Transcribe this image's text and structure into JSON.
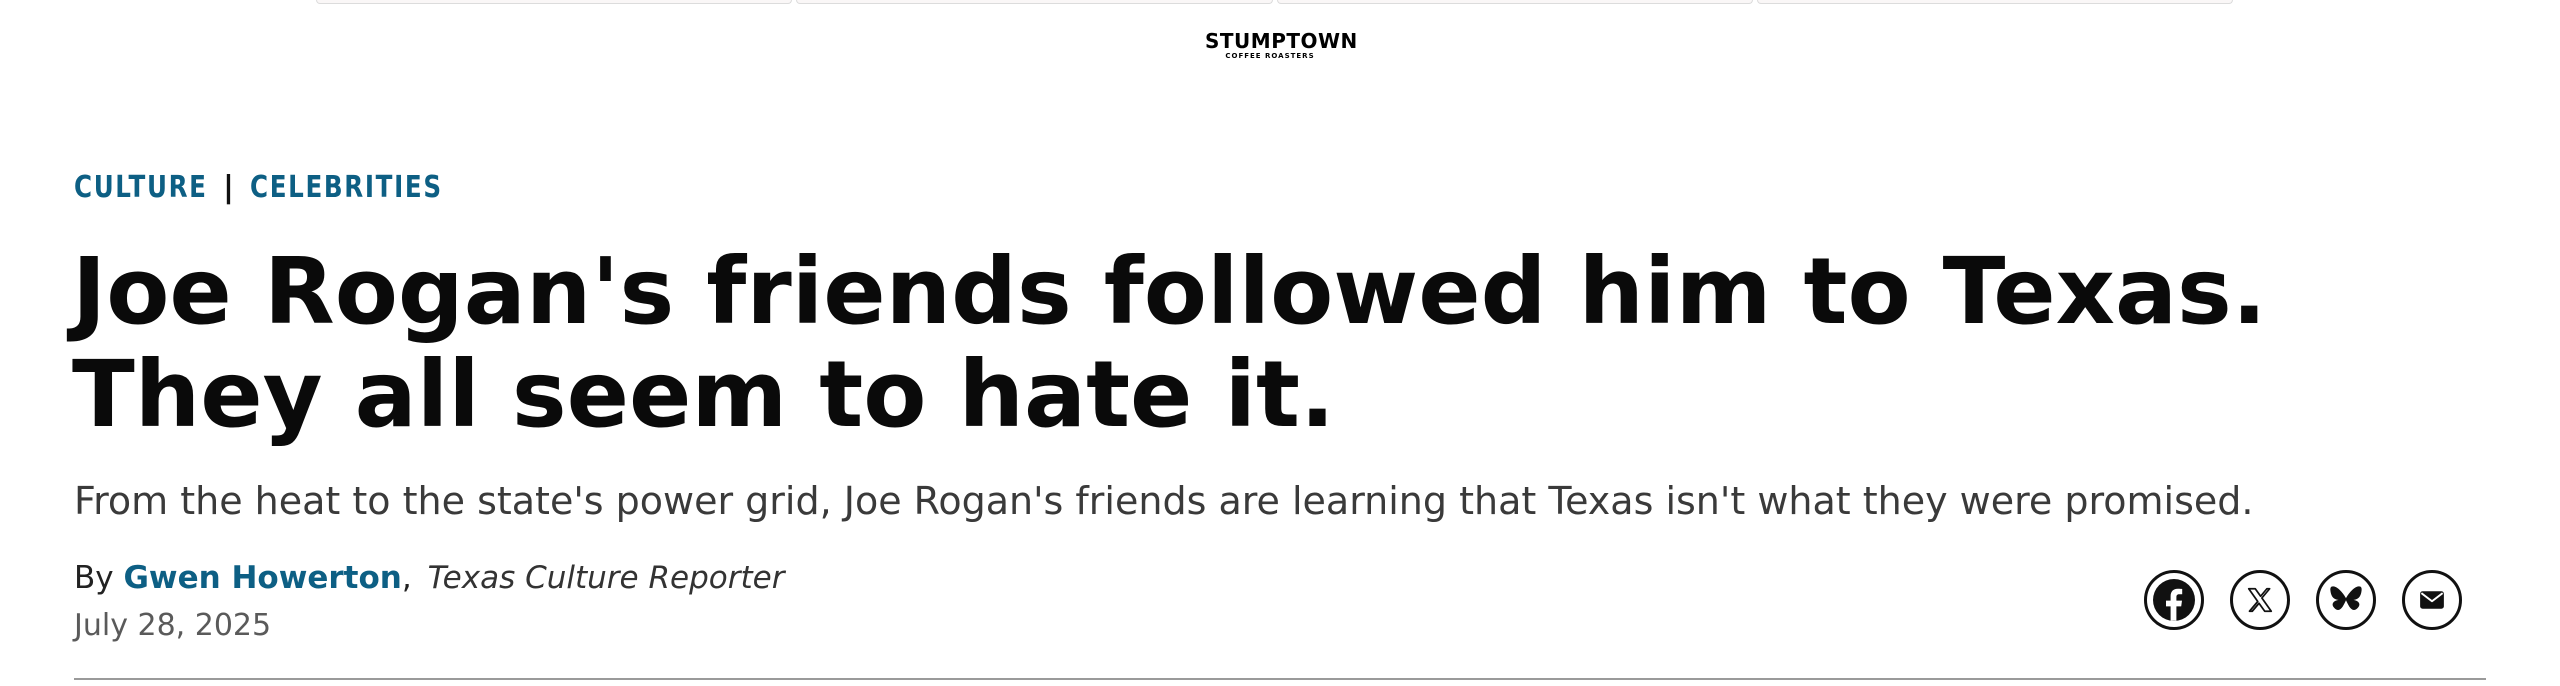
{
  "sponsor": {
    "name": "STUMPTOWN",
    "sub": "COFFEE ROASTERS"
  },
  "breadcrumbs": [
    {
      "label": "CULTURE"
    },
    {
      "label": "CELEBRITIES"
    }
  ],
  "breadcrumb_separator": "|",
  "article": {
    "headline": "Joe Rogan's friends followed him to Texas. They all seem to hate it.",
    "dek": "From the heat to the state's power grid, Joe Rogan's friends are learning that Texas isn't what they were promised.",
    "byline_prefix": "By",
    "author": "Gwen Howerton",
    "author_sep": ",",
    "author_role": "Texas Culture Reporter",
    "date": "July 28, 2025"
  },
  "share": [
    {
      "icon": "facebook-icon"
    },
    {
      "icon": "x-icon"
    },
    {
      "icon": "bluesky-icon"
    },
    {
      "icon": "email-icon"
    }
  ],
  "colors": {
    "accent": "#0d5f84",
    "text": "#0a0a0a",
    "muted": "#5a5a5a"
  }
}
